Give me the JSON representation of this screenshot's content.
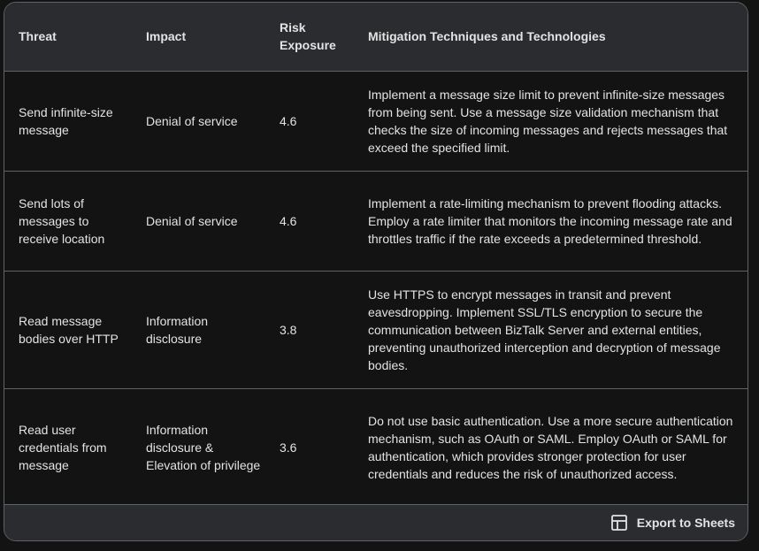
{
  "table": {
    "headers": {
      "threat": "Threat",
      "impact": "Impact",
      "risk_line1": "Risk",
      "risk_line2": "Exposure",
      "mitigation": "Mitigation Techniques and Technologies"
    },
    "rows": [
      {
        "threat": "Send infinite-size message",
        "impact": "Denial of service",
        "risk": "4.6",
        "mitigation": "Implement a message size limit to prevent infinite-size messages from being sent. Use a message size validation mechanism that checks the size of incoming messages and rejects messages that exceed the specified limit."
      },
      {
        "threat": "Send lots of messages to receive location",
        "impact": "Denial of service",
        "risk": "4.6",
        "mitigation": "Implement a rate-limiting mechanism to prevent flooding attacks. Employ a rate limiter that monitors the incoming message rate and throttles traffic if the rate exceeds a predetermined threshold."
      },
      {
        "threat": "Read message bodies over HTTP",
        "impact": "Information disclosure",
        "risk": "3.8",
        "mitigation": "Use HTTPS to encrypt messages in transit and prevent eavesdropping. Implement SSL/TLS encryption to secure the communication between BizTalk Server and external entities, preventing unauthorized interception and decryption of message bodies."
      },
      {
        "threat": "Read user credentials from message",
        "impact": "Information disclosure & Elevation of privilege",
        "risk": "3.6",
        "mitigation": "Do not use basic authentication. Use a more secure authentication mechanism, such as OAuth or SAML. Employ OAuth or SAML for authentication, which provides stronger protection for user credentials and reduces the risk of unauthorized access."
      }
    ]
  },
  "footer": {
    "export_label": "Export to Sheets",
    "export_icon": "sheets-grid-icon"
  },
  "colors": {
    "background": "#131314",
    "header_bg": "#2b2c2f",
    "border": "#5f6368",
    "text": "#e3e3e3"
  }
}
